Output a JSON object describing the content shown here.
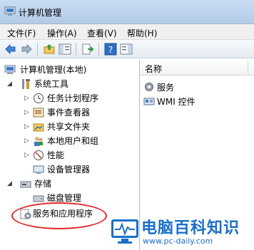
{
  "window": {
    "title": "计算机管理"
  },
  "menubar": {
    "items": [
      "文件(F)",
      "操作(A)",
      "查看(V)",
      "帮助(H)"
    ]
  },
  "toolbar": {
    "buttons": [
      "back-arrow-icon",
      "forward-arrow-icon",
      "up-folder-icon",
      "show-hide-tree-icon",
      "export-list-icon",
      "help-icon",
      "show-action-pane-icon"
    ]
  },
  "tree": {
    "root": "计算机管理(本地)",
    "system_tools": "系统工具",
    "task_scheduler": "任务计划程序",
    "event_viewer": "事件查看器",
    "shared_folders": "共享文件夹",
    "local_users": "本地用户和组",
    "performance": "性能",
    "device_manager": "设备管理器",
    "storage": "存储",
    "disk_management": "磁盘管理",
    "services_apps": "服务和应用程序"
  },
  "list": {
    "column_name": "名称",
    "items": [
      "服务",
      "WMI 控件"
    ]
  },
  "watermark": {
    "title": "电脑百科知识",
    "url": "www.pc-daily.com"
  },
  "colors": {
    "highlight": "#e3262a",
    "watermark": "#1a6fc7"
  }
}
